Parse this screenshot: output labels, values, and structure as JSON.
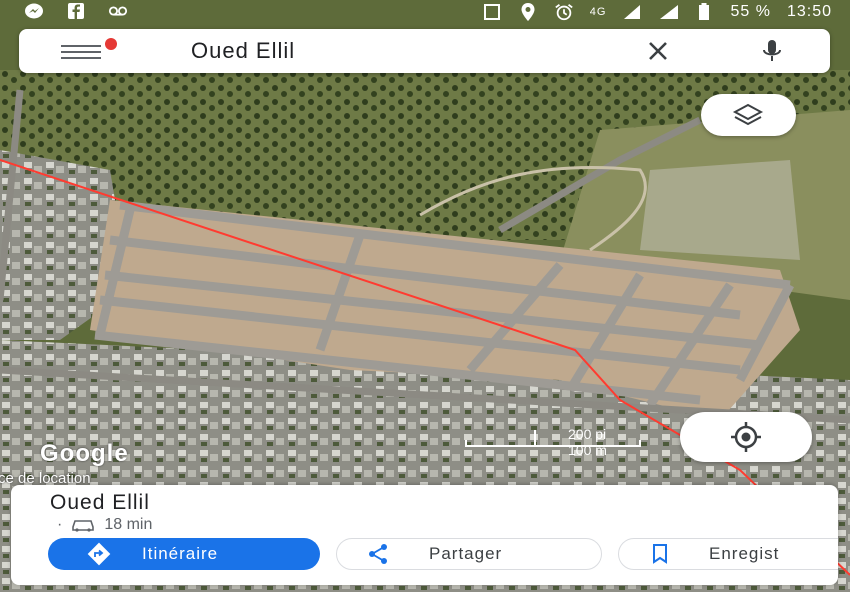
{
  "status_bar": {
    "network": "4G",
    "battery": "55 %",
    "time": "13:50",
    "left_icons": [
      "messenger-icon",
      "facebook-icon",
      "voicemail-icon"
    ],
    "right_icons": [
      "square-icon",
      "location-pin-icon",
      "alarm-icon",
      "signal-icon",
      "signal-icon",
      "battery-icon"
    ]
  },
  "search": {
    "query": "Oued Ellil",
    "menu_icon": "menu-icon",
    "notification_color": "#e53935"
  },
  "map": {
    "scale_top": "200 pi",
    "scale_bottom": "100 m",
    "attribution": "Google",
    "partial_label": "ce de location"
  },
  "place_card": {
    "name": "Oued Ellil",
    "eta": "18 min",
    "travel_mode_icon": "car-icon",
    "buttons": {
      "directions": "Itinéraire",
      "share": "Partager",
      "save": "Enregist"
    }
  },
  "colors": {
    "primary": "#1a73e8",
    "route_line": "#ff3b30"
  }
}
